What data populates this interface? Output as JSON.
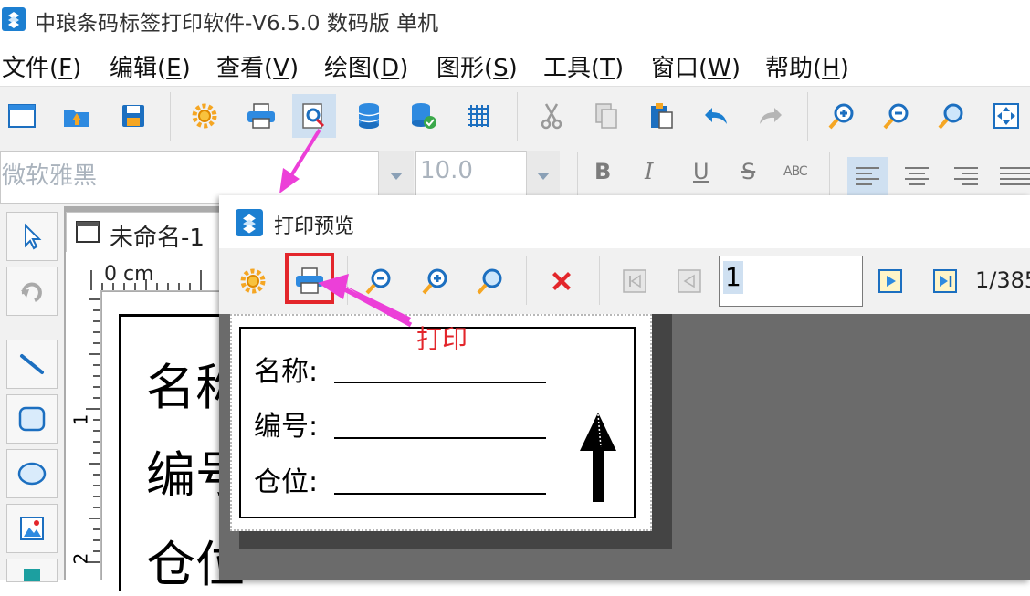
{
  "window": {
    "title": "中琅条码标签打印软件-V6.5.0 数码版 单机"
  },
  "menu": {
    "items": [
      {
        "label": "文件(F)",
        "mnemonic": "F"
      },
      {
        "label": "编辑(E)",
        "mnemonic": "E"
      },
      {
        "label": "查看(V)",
        "mnemonic": "V"
      },
      {
        "label": "绘图(D)",
        "mnemonic": "D"
      },
      {
        "label": "图形(S)",
        "mnemonic": "S"
      },
      {
        "label": "工具(T)",
        "mnemonic": "T"
      },
      {
        "label": "窗口(W)",
        "mnemonic": "W"
      },
      {
        "label": "帮助(H)",
        "mnemonic": "H"
      }
    ]
  },
  "toolbar": {
    "icons": [
      "new-window-icon",
      "open-file-icon",
      "save-icon",
      "settings-gear-icon",
      "print-icon",
      "print-preview-icon",
      "database-icon",
      "database-check-icon",
      "grid-icon",
      "cut-icon",
      "copy-icon",
      "paste-icon",
      "undo-icon",
      "redo-icon",
      "zoom-in-icon",
      "zoom-out-icon",
      "zoom-icon",
      "fit-page-icon"
    ],
    "active": "print-preview-icon"
  },
  "fontbar": {
    "font_name": "微软雅黑",
    "font_size": "10.0",
    "bold": "B",
    "italic": "I",
    "underline": "U",
    "strike": "S",
    "char_spacing": "ABC"
  },
  "document": {
    "tab_title": "未命名-1",
    "ruler_unit": "0 cm",
    "ruler_marks": [
      "1",
      "2"
    ],
    "fields": [
      "名称",
      "编号",
      "仓位"
    ]
  },
  "preview": {
    "title": "打印预览",
    "current_page": "1",
    "page_total": "1/385",
    "annotation": "打印",
    "label": {
      "rows": [
        "名称:",
        "编号:",
        "仓位:"
      ]
    }
  },
  "colors": {
    "accent_red": "#e3262b",
    "annotation_magenta": "#ec3fd8",
    "selection_blue": "#cfe0f1"
  }
}
